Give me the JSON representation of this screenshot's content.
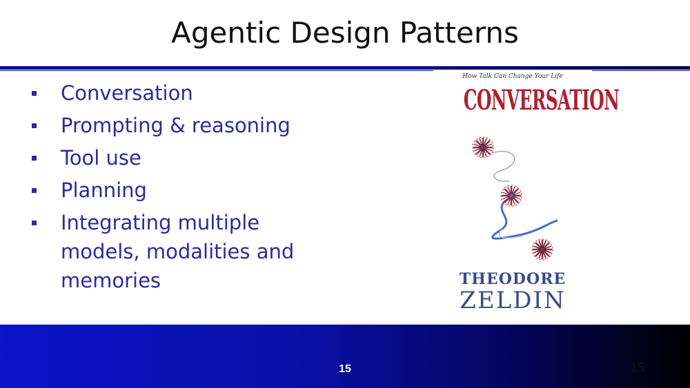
{
  "slide": {
    "title": "Agentic Design Patterns",
    "bullets": [
      "Conversation",
      "Prompting & reasoning",
      "Tool use",
      "Planning",
      "Integrating multiple models, modalities and memories"
    ],
    "page_number": "15",
    "corner_number": "15"
  },
  "book_cover": {
    "tagline": "How Talk Can Change Your Life",
    "title": "CONVERSATION",
    "author_first": "THEODORE",
    "author_last": "ZELDIN",
    "colors": {
      "title": "#b02030",
      "author": "#3a4a8a"
    }
  },
  "colors": {
    "bullet_text": "#2b2b9a",
    "rule": "#0b0f8c",
    "footer_start": "#0a14c8",
    "footer_end": "#000000"
  }
}
